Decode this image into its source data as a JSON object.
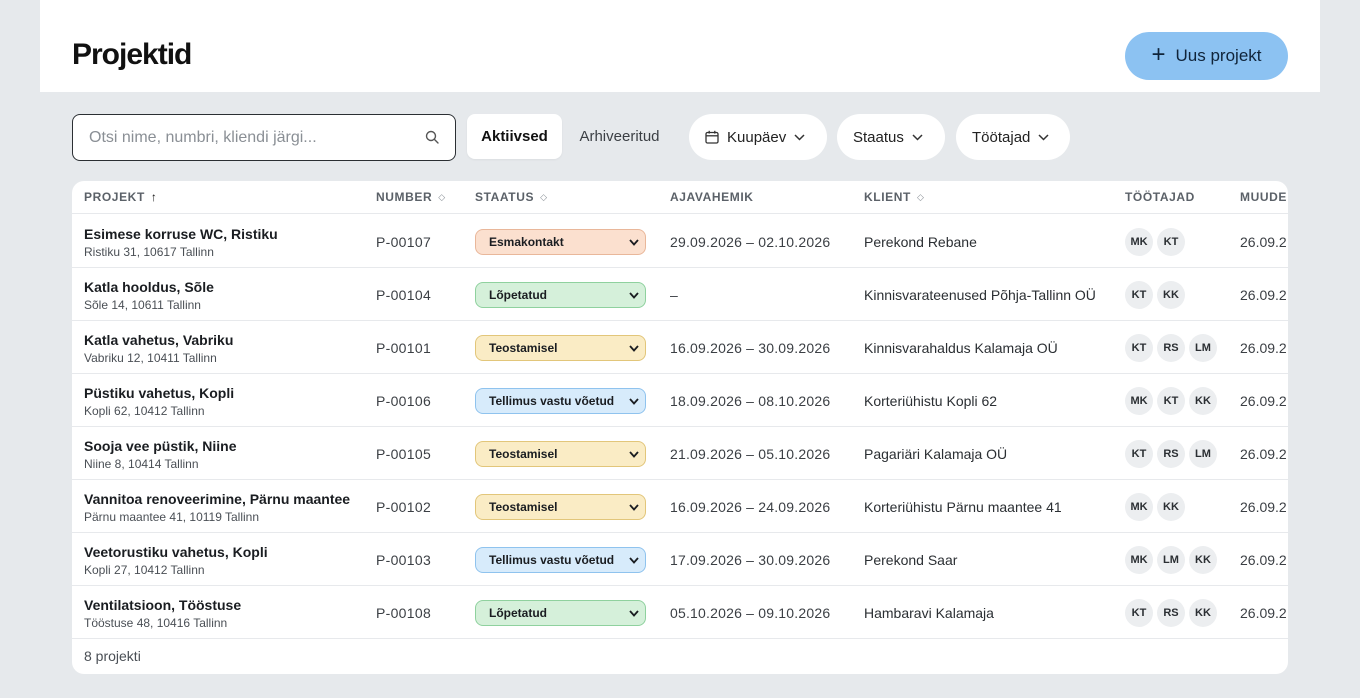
{
  "header": {
    "title": "Projektid",
    "new_button_label": "Uus projekt"
  },
  "toolbar": {
    "search_placeholder": "Otsi nime, numbri, kliendi järgi...",
    "tab_active": "Aktiivsed",
    "tab_archived": "Arhiveeritud",
    "filter_date": "Kuupäev",
    "filter_status": "Staatus",
    "filter_employees": "Töötajad"
  },
  "table": {
    "headers": {
      "project": "PROJEKT",
      "number": "NUMBER",
      "status": "STAATUS",
      "period": "AJAVAHEMIK",
      "client": "KLIENT",
      "employees": "TÖÖTAJAD",
      "modified": "MUUDE"
    },
    "rows": [
      {
        "name": "Esimese korruse WC, Ristiku",
        "address": "Ristiku 31, 10617 Tallinn",
        "number": "P-00107",
        "status": "Esmakontakt",
        "status_key": "esma",
        "period": "29.09.2026 – 02.10.2026",
        "client": "Perekond Rebane",
        "employees": [
          "MK",
          "KT"
        ],
        "modified": "26.09.2"
      },
      {
        "name": "Katla hooldus, Sõle",
        "address": "Sõle 14, 10611 Tallinn",
        "number": "P-00104",
        "status": "Lõpetatud",
        "status_key": "lopp",
        "period": "–",
        "client": "Kinnisvarateenused Põhja-Tallinn OÜ",
        "employees": [
          "KT",
          "KK"
        ],
        "modified": "26.09.2"
      },
      {
        "name": "Katla vahetus, Vabriku",
        "address": "Vabriku 12, 10411 Tallinn",
        "number": "P-00101",
        "status": "Teostamisel",
        "status_key": "teos",
        "period": "16.09.2026 – 30.09.2026",
        "client": "Kinnisvarahaldus Kalamaja OÜ",
        "employees": [
          "KT",
          "RS",
          "LM"
        ],
        "modified": "26.09.2"
      },
      {
        "name": "Püstiku vahetus, Kopli",
        "address": "Kopli 62, 10412 Tallinn",
        "number": "P-00106",
        "status": "Tellimus vastu võetud",
        "status_key": "tell",
        "period": "18.09.2026 – 08.10.2026",
        "client": "Korteriühistu Kopli 62",
        "employees": [
          "MK",
          "KT",
          "KK"
        ],
        "modified": "26.09.2"
      },
      {
        "name": "Sooja vee püstik, Niine",
        "address": "Niine 8, 10414 Tallinn",
        "number": "P-00105",
        "status": "Teostamisel",
        "status_key": "teos",
        "period": "21.09.2026 – 05.10.2026",
        "client": "Pagariäri Kalamaja OÜ",
        "employees": [
          "KT",
          "RS",
          "LM"
        ],
        "modified": "26.09.2"
      },
      {
        "name": "Vannitoa renoveerimine, Pärnu maantee",
        "address": "Pärnu maantee 41, 10119 Tallinn",
        "number": "P-00102",
        "status": "Teostamisel",
        "status_key": "teos",
        "period": "16.09.2026 – 24.09.2026",
        "client": "Korteriühistu Pärnu maantee 41",
        "employees": [
          "MK",
          "KK"
        ],
        "modified": "26.09.2"
      },
      {
        "name": "Veetorustiku vahetus, Kopli",
        "address": "Kopli 27, 10412 Tallinn",
        "number": "P-00103",
        "status": "Tellimus vastu võetud",
        "status_key": "tell",
        "period": "17.09.2026 – 30.09.2026",
        "client": "Perekond Saar",
        "employees": [
          "MK",
          "LM",
          "KK"
        ],
        "modified": "26.09.2"
      },
      {
        "name": "Ventilatsioon, Tööstuse",
        "address": "Tööstuse 48, 10416 Tallinn",
        "number": "P-00108",
        "status": "Lõpetatud",
        "status_key": "lopp",
        "period": "05.10.2026 – 09.10.2026",
        "client": "Hambaravi Kalamaja",
        "employees": [
          "KT",
          "RS",
          "KK"
        ],
        "modified": "26.09.2"
      }
    ],
    "footer_count": "8 projekti"
  }
}
